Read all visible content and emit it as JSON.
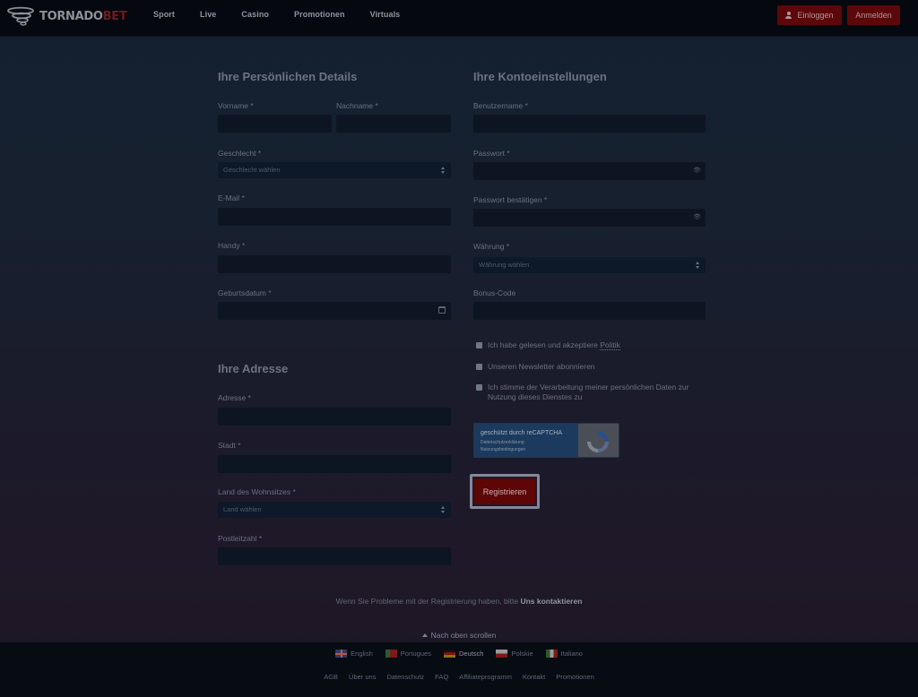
{
  "header": {
    "logo": {
      "text_a": "TORNADO",
      "text_b": "BET"
    },
    "nav": [
      "Sport",
      "Live",
      "Casino",
      "Promotionen",
      "Virtuals"
    ],
    "login_label": "Einloggen",
    "register_label": "Anmelden"
  },
  "personal": {
    "title": "Ihre Persönlichen Details",
    "firstname_label": "Vorname *",
    "lastname_label": "Nachname *",
    "gender_label": "Geschlecht *",
    "gender_value": "Geschlecht wählen",
    "email_label": "E-Mail *",
    "phone_label": "Handy *",
    "birthdate_label": "Geburtsdatum *"
  },
  "address": {
    "title": "Ihre Adresse",
    "street_label": "Adresse *",
    "city_label": "Stadt *",
    "country_label": "Land des Wohnsitzes *",
    "country_value": "Land wählen",
    "zip_label": "Postleitzahl *"
  },
  "account": {
    "title": "Ihre Kontoeinstellungen",
    "username_label": "Benutzername *",
    "password_label": "Passwort *",
    "password_confirm_label": "Passwort bestätigen *",
    "currency_label": "Währung *",
    "currency_value": "Währung wählen",
    "bonus_label": "Bonus-Code"
  },
  "checkboxes": {
    "policy_text": "Ich habe gelesen und akzeptiere ",
    "policy_link": "Politik",
    "newsletter": "Unseren Newsletter abonnieren",
    "data_processing": "Ich stimme der Verarbeitung meiner persönlichen Daten zur Nutzung dieses Dienstes zu"
  },
  "captcha": {
    "title": "geschützt durch reCAPTCHA",
    "privacy": "Datenschutzerklärung",
    "terms": "Nutzungsbedingungen"
  },
  "register_button": "Registrieren",
  "help": {
    "text": "Wenn Sie Probleme mit der Registrierung haben, bitte ",
    "link": "Uns kontaktieren"
  },
  "scroll_top": "Nach oben scrollen",
  "footer": {
    "languages": [
      "English",
      "Portugues",
      "Deutsch",
      "Polskie",
      "Italiano"
    ],
    "active_language": "Deutsch",
    "links": [
      "AGB",
      "Über uns",
      "Datenschutz",
      "FAQ",
      "Affiliateprogramm",
      "Kontakt",
      "Promotionen"
    ]
  },
  "colors": {
    "accent": "#5e0506",
    "header_bg": "#05080e",
    "field_bg": "#0e1522"
  }
}
